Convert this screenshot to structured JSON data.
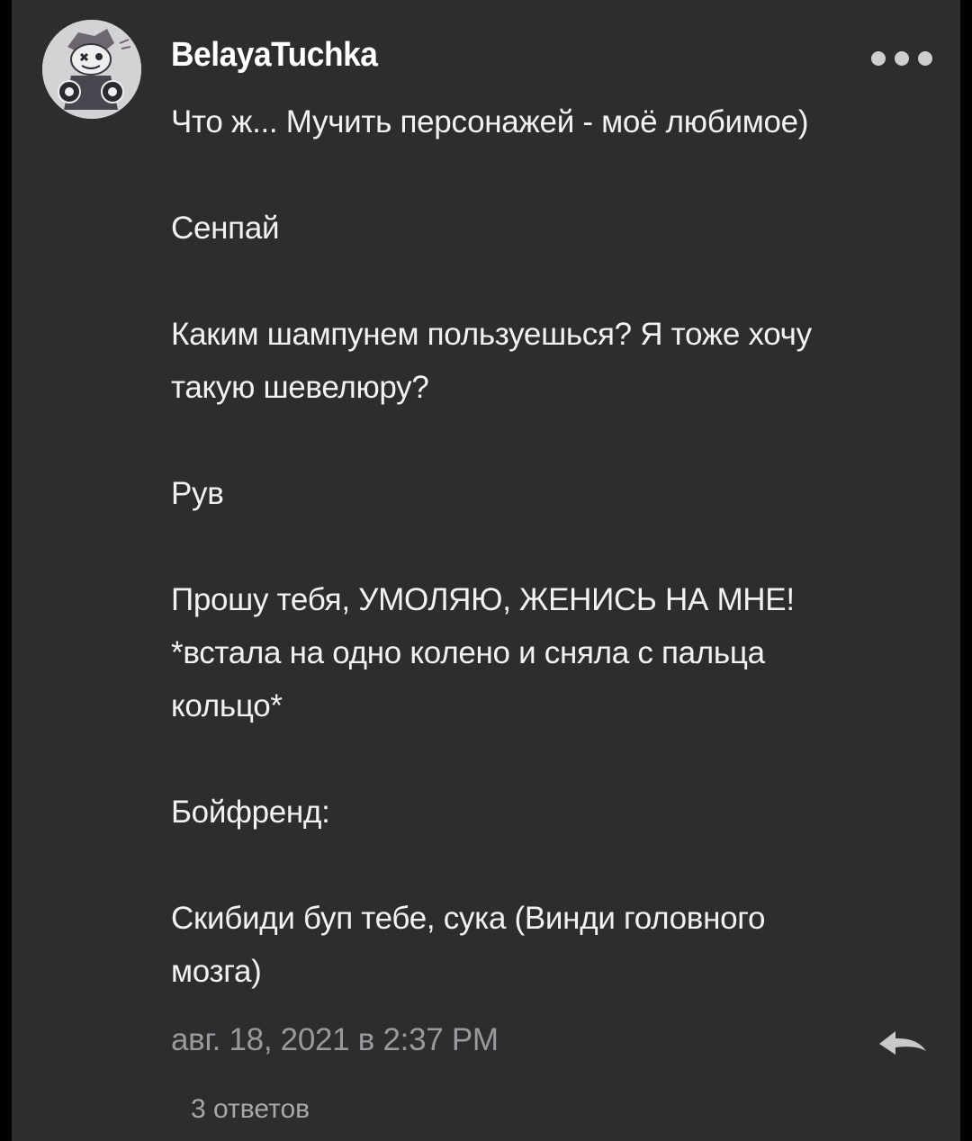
{
  "comment": {
    "author": "BelayaTuchka",
    "avatar_icon": "character-avatar-icon",
    "lines": [
      "Что ж... Мучить персонажей - моё любимое)",
      "",
      "Сенпай",
      "",
      "Каким шампунем пользуешься? Я тоже хочу",
      "такую шевелюру?",
      "",
      "Рув",
      "",
      "Прошу тебя, УМОЛЯЮ, ЖЕНИСЬ НА МНЕ!",
      "*встала на одно колено и сняла с пальца",
      "кольцо*",
      "",
      "Бойфренд:",
      "",
      "Скибиди буп тебе, сука (Винди головного",
      "мозга)"
    ],
    "timestamp": "авг. 18, 2021 в 2:37 PM",
    "replies_label": "3 ответов",
    "more_icon": "more-dots-icon",
    "reply_icon": "reply-arrow-icon"
  },
  "colors": {
    "background": "#000000",
    "card": "#2d2c2f",
    "text": "#f2f2f2",
    "muted": "#9a999c"
  }
}
